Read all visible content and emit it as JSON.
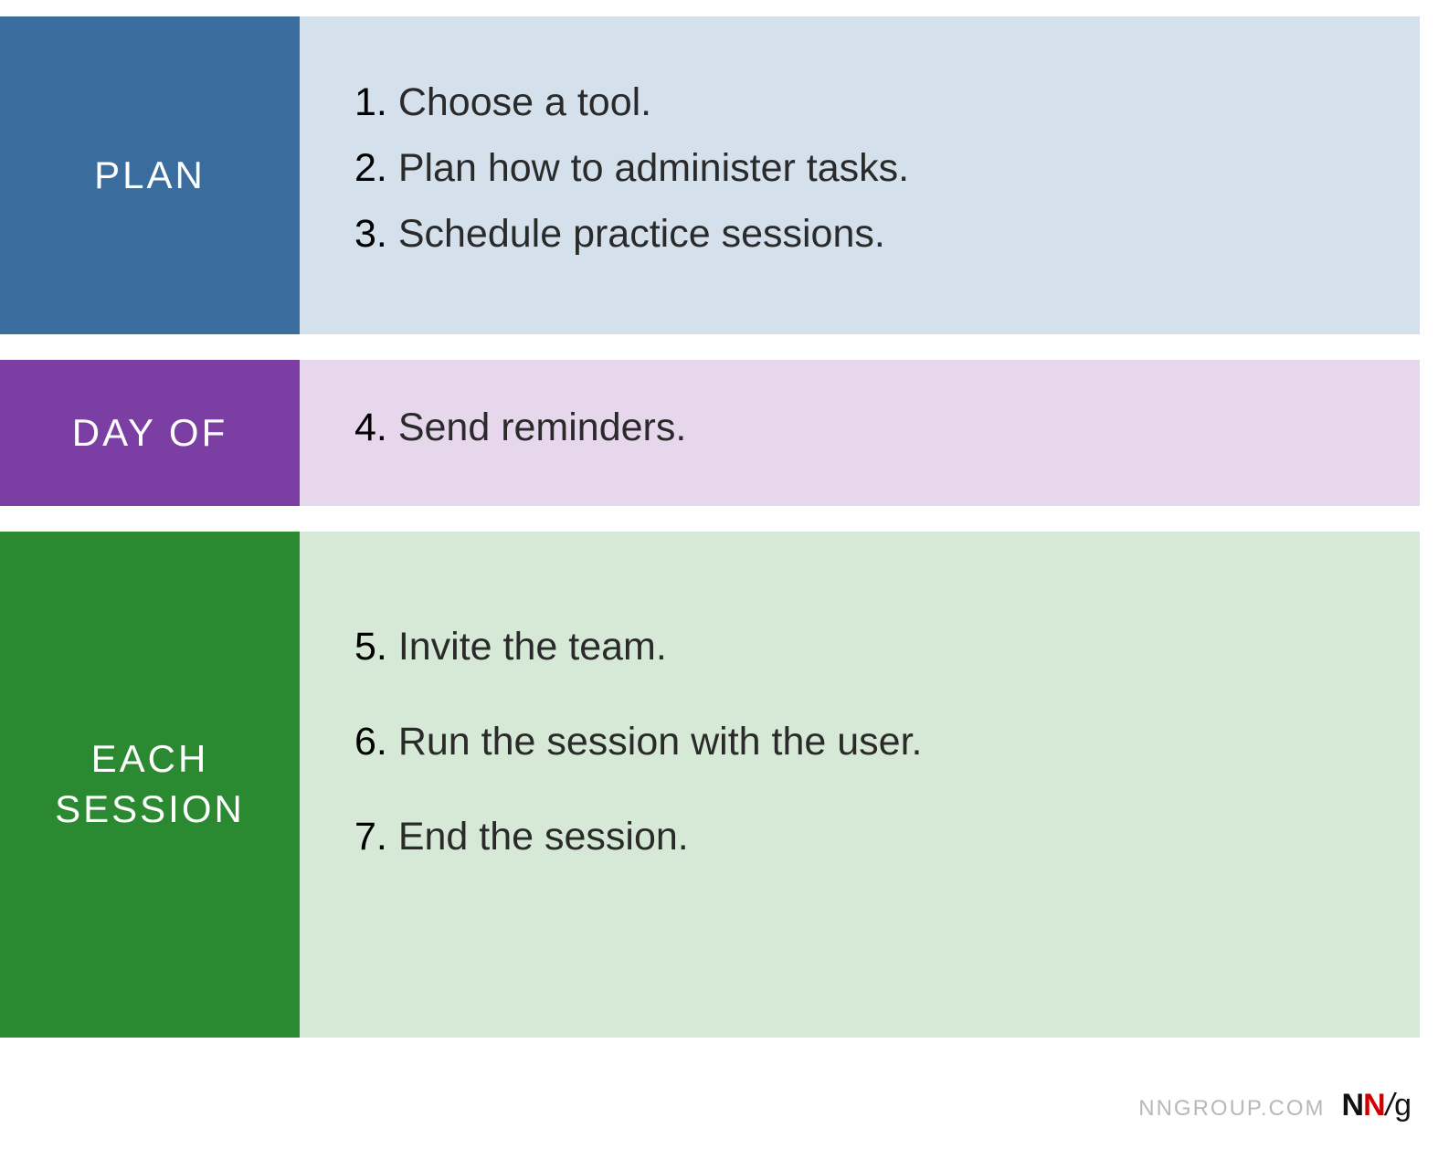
{
  "rows": [
    {
      "label": "PLAN",
      "items": [
        {
          "num": "1.",
          "text": " Choose a tool."
        },
        {
          "num": "2.",
          "text": " Plan how to administer tasks."
        },
        {
          "num": "3.",
          "text": " Schedule practice sessions."
        }
      ]
    },
    {
      "label": "DAY OF",
      "items": [
        {
          "num": "4.",
          "text": " Send reminders."
        }
      ]
    },
    {
      "label": "EACH SESSION",
      "items": [
        {
          "num": "5.",
          "text": " Invite the team."
        },
        {
          "num": "6.",
          "text": " Run the session with the user."
        },
        {
          "num": "7.",
          "text": " End the session."
        }
      ]
    }
  ],
  "footer": {
    "url": "NNGROUP.COM",
    "logo_n1": "N",
    "logo_n2": "N",
    "logo_slash": "/",
    "logo_g": "g"
  }
}
